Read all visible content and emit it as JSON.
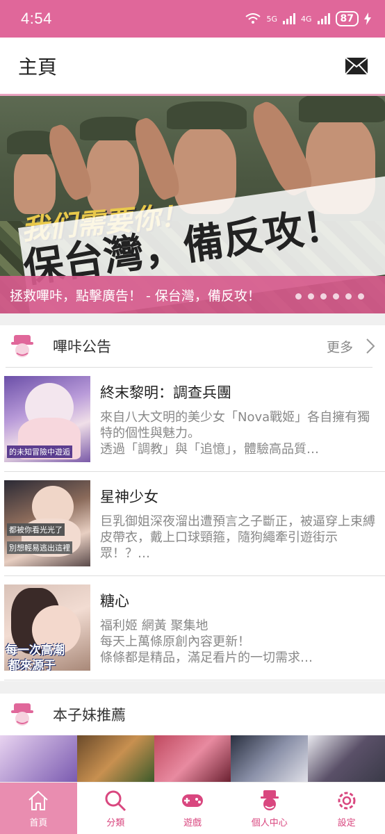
{
  "status": {
    "time": "4:54",
    "network1": "5G",
    "network2": "4G",
    "battery": "87"
  },
  "header": {
    "title": "主頁"
  },
  "banner": {
    "slogan_line1": "我们需要你！",
    "slogan_line2": "保台灣，備反攻！",
    "caption": "拯救嗶咔，點擊廣告！ - 保台灣，備反攻！"
  },
  "announcements": {
    "title": "嗶咔公告",
    "more": "更多",
    "items": [
      {
        "name": "終末黎明：調查兵團",
        "desc1": "來自八大文明的美少女「Nova戰姬」各自擁有獨特的個性與魅力。",
        "desc2": "透過「調教」與「追憶」，體驗高品質…",
        "thumb_text": "的未知冒險中遊逅"
      },
      {
        "name": "星神少女",
        "desc1": "巨乳御姐深夜溜出遭預言之子斷正，被逼穿上束縛皮帶衣，戴上口球頸箍，隨狗繩牽引遊街示眾！？…",
        "desc2": "",
        "thumb_text1": "都被你看光光了",
        "thumb_text2": "別想輕易逃出這裡"
      },
      {
        "name": "糖心",
        "desc1": "福利姬 網黃 聚集地",
        "desc2": "每天上萬條原創內容更新！",
        "desc3": "條條都是精品，滿足看片的一切需求…",
        "thumb_text1": "每一次高潮",
        "thumb_text2": "都來源于"
      }
    ]
  },
  "recommend": {
    "title": "本子妹推薦"
  },
  "tabs": [
    {
      "label": "首頁",
      "icon": "home-icon"
    },
    {
      "label": "分類",
      "icon": "search-icon"
    },
    {
      "label": "遊戲",
      "icon": "gamepad-icon"
    },
    {
      "label": "個人中心",
      "icon": "profile-icon"
    },
    {
      "label": "設定",
      "icon": "gear-icon"
    }
  ],
  "colors": {
    "brand": "#e0679a",
    "tab_active": "#e98db0"
  }
}
